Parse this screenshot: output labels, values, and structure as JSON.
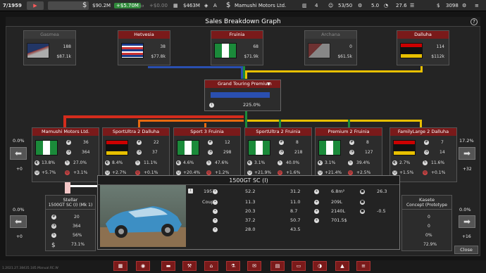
{
  "topbar": {
    "date": "7/1959",
    "money": "$90.2M",
    "income": "+$5.70M",
    "zero": "+$0.00",
    "value": "$463M",
    "rating": "A",
    "company": "Mamushi Motors Ltd.",
    "count_a": "4",
    "capacity": "53/50",
    "score": "5.0",
    "temp": "27.6",
    "cash_small": "3098"
  },
  "window": {
    "title": "Sales Breakdown Graph",
    "help": "?"
  },
  "countries": [
    {
      "name": "Gasmea",
      "units": "188",
      "revenue": "$87.1k",
      "dim": true
    },
    {
      "name": "Hetvesia",
      "units": "38",
      "revenue": "$77.8k",
      "dim": false
    },
    {
      "name": "Fruinia",
      "units": "68",
      "revenue": "$71.9k",
      "dim": false
    },
    {
      "name": "Archana",
      "units": "0",
      "revenue": "$61.5k",
      "dim": true
    },
    {
      "name": "Dalluha",
      "units": "114",
      "revenue": "$112k",
      "dim": false
    }
  ],
  "trim": {
    "name": "Grand Touring Premium",
    "percent": "225.0%"
  },
  "cards": [
    {
      "name": "Mamushi Motors Ltd.",
      "a": "36",
      "b": "364",
      "c": "13.8%",
      "d": "27.0%",
      "e": "+5.7%",
      "f": "+3.1%"
    },
    {
      "name": "SportUltra 2 Dalluha",
      "a": "22",
      "b": "37",
      "c": "8.4%",
      "d": "11.1%",
      "e": "+2.7%",
      "f": "+0.1%"
    },
    {
      "name": "Sport 3 Fruinia",
      "a": "12",
      "b": "298",
      "c": "4.6%",
      "d": "47.6%",
      "e": "+20.4%",
      "f": "+1.2%"
    },
    {
      "name": "SportUltra 2 Fruinia",
      "a": "8",
      "b": "218",
      "c": "3.1%",
      "d": "40.0%",
      "e": "+21.9%",
      "f": "+1.6%"
    },
    {
      "name": "Premium 2 Fruinia",
      "a": "8",
      "b": "127",
      "c": "3.1%",
      "d": "39.4%",
      "e": "+21.4%",
      "f": "+2.5%"
    },
    {
      "name": "FamilyLarge 2 Dalluha",
      "a": "7",
      "b": "14",
      "c": "2.7%",
      "d": "11.6%",
      "e": "+1.5%",
      "f": "+0.1%"
    }
  ],
  "left_nav": {
    "pct": "0.0%",
    "count": "+0"
  },
  "right_nav": {
    "pct": "17.2%",
    "count": "+32"
  },
  "left_nav2": {
    "pct": "0.0%",
    "count": "+0"
  },
  "right_nav2": {
    "pct": "0.0%",
    "count": "+16"
  },
  "stellar": {
    "title": "Stellar",
    "sub": "1500GT SC (I) (Mk 1)",
    "a": "20",
    "b": "364",
    "c": "56%",
    "d": "73.1%"
  },
  "kasete": {
    "title": "Kasete",
    "sub": "Concept (Prototype",
    "a": "0",
    "b": "0",
    "c": "0%",
    "d": "72.9%"
  },
  "popup": {
    "title": "1500GT SC (I)",
    "year": "1957",
    "body": "Coupe",
    "col1": [
      "52.2",
      "11.3",
      "20.3",
      "37.2",
      "28.0"
    ],
    "col2": [
      "31.2",
      "11.0",
      "8.7",
      "50.7",
      "43.5"
    ],
    "col3": [
      "6.8m²",
      "209L",
      "2140L",
      "701.5$"
    ],
    "col4": [
      "26.3",
      "",
      "-0.5"
    ]
  },
  "close_label": "Close",
  "footer": "1.2021.27.38435.185.Manual.RC.W"
}
